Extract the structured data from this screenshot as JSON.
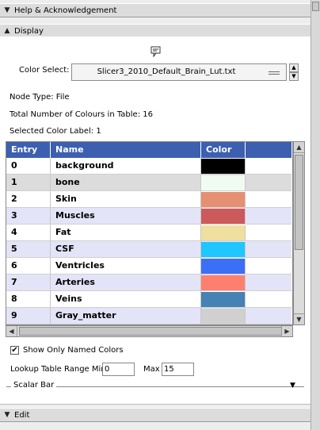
{
  "sections": {
    "help": {
      "title": "Help & Acknowledgement",
      "toggle": "▼"
    },
    "display": {
      "title": "Display",
      "toggle": "▲"
    },
    "edit": {
      "title": "Edit",
      "toggle": "▼"
    }
  },
  "display": {
    "color_select_label": "Color Select:",
    "color_select_value": "Slicer3_2010_Default_Brain_Lut.txt",
    "node_type": "Node Type: File",
    "total_colours": "Total Number of Colours in Table: 16",
    "selected_label": "Selected Color Label: 1",
    "table": {
      "headers": [
        "Entry",
        "Name",
        "Color"
      ],
      "rows": [
        {
          "entry": "0",
          "name": "background",
          "color": "#000000"
        },
        {
          "entry": "1",
          "name": "bone",
          "color": "#f0fcf0"
        },
        {
          "entry": "2",
          "name": "Skin",
          "color": "#e59070"
        },
        {
          "entry": "3",
          "name": "Muscles",
          "color": "#cc5a5a"
        },
        {
          "entry": "4",
          "name": "Fat",
          "color": "#f0e0a0"
        },
        {
          "entry": "5",
          "name": "CSF",
          "color": "#1fc6ff"
        },
        {
          "entry": "6",
          "name": "Ventricles",
          "color": "#3b6ff5"
        },
        {
          "entry": "7",
          "name": "Arteries",
          "color": "#ff7f6e"
        },
        {
          "entry": "8",
          "name": "Veins",
          "color": "#4682b4"
        },
        {
          "entry": "9",
          "name": "Gray_matter",
          "color": "#d0d0d0"
        }
      ]
    },
    "show_only_named": "Show Only Named Colors",
    "show_only_named_checked": true,
    "range_label": "Lookup Table Range Min",
    "range_min": "0",
    "max_label": "Max",
    "range_max": "15",
    "scalar_bar_label": "Scalar Bar"
  },
  "colors": {
    "header_blue": "#3c5fb0",
    "row_alt": "#e4e4f8",
    "selected_row": "#dcdcdc"
  }
}
